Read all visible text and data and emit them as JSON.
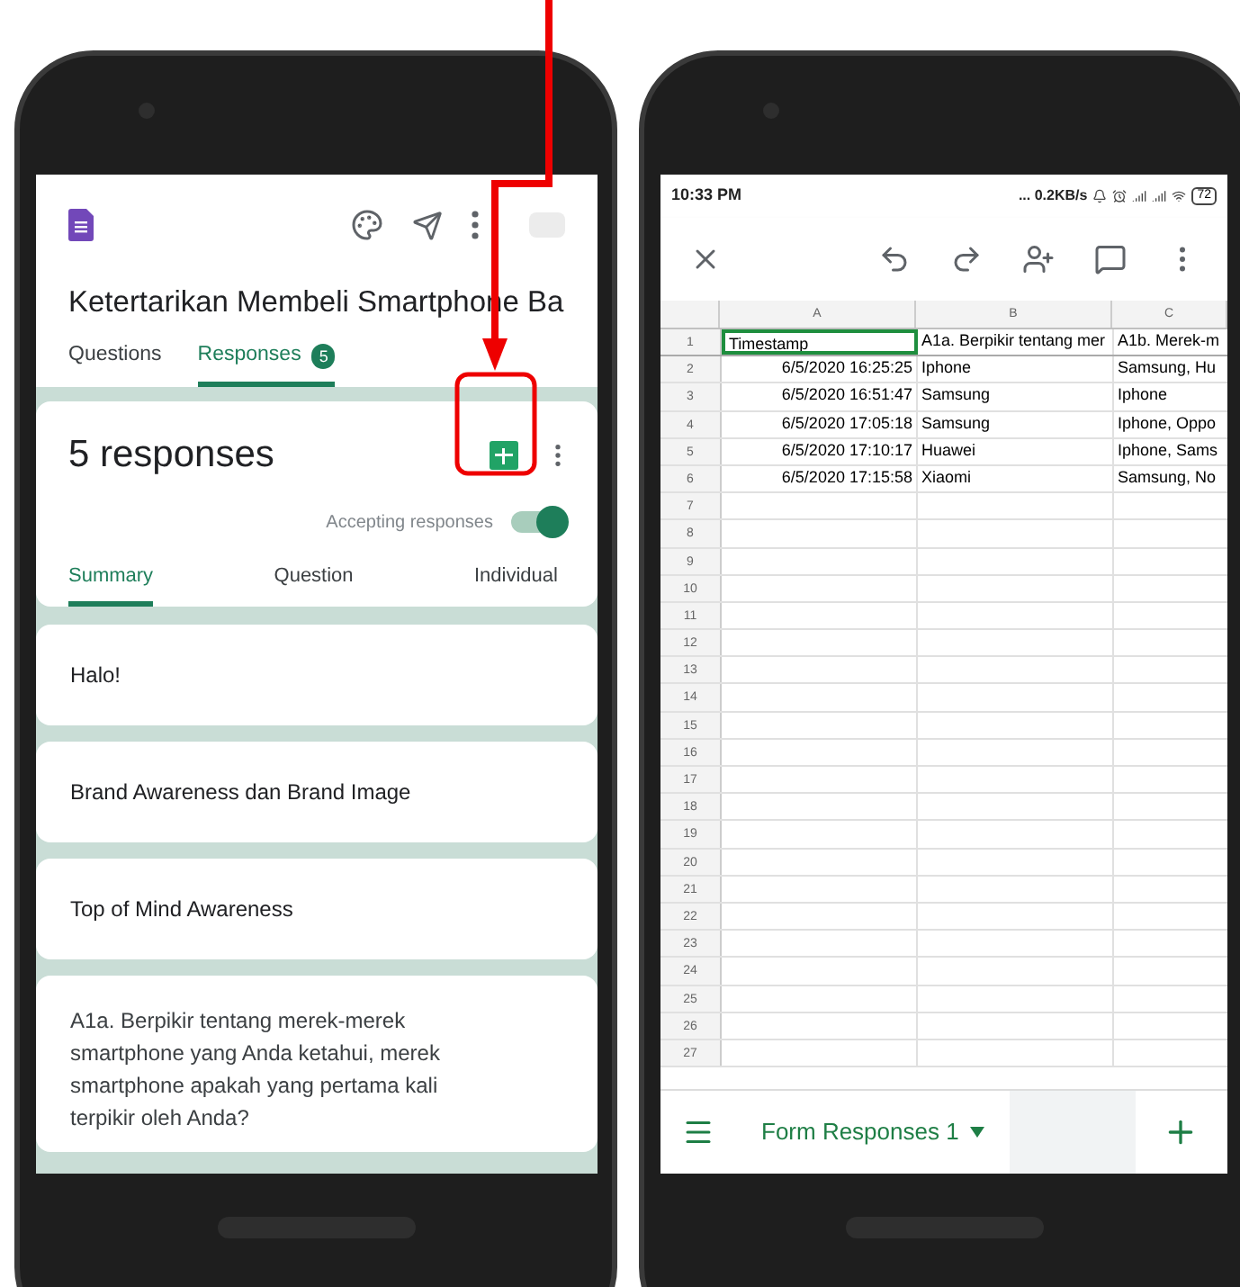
{
  "left_phone": {
    "form_title": "Ketertarikan Membeli Smartphone Ba",
    "tabs": [
      {
        "label": "Questions",
        "selected": false
      },
      {
        "label": "Responses",
        "selected": true,
        "badge": "5"
      }
    ],
    "responses_card": {
      "title": "5 responses",
      "accepting_label": "Accepting responses",
      "accepting": true,
      "subtabs": [
        {
          "label": "Summary",
          "selected": true
        },
        {
          "label": "Question",
          "selected": false
        },
        {
          "label": "Individual",
          "selected": false
        }
      ]
    },
    "cards": [
      {
        "kind": "section",
        "text": "Halo!"
      },
      {
        "kind": "section",
        "text": "Brand Awareness dan Brand Image"
      },
      {
        "kind": "section",
        "text": "Top of Mind Awareness"
      },
      {
        "kind": "question",
        "text": "A1a. Berpikir tentang merek-merek smartphone yang Anda ketahui, merek smartphone apakah yang pertama kali terpikir oleh Anda?"
      }
    ]
  },
  "right_phone": {
    "status_bar": {
      "time": "10:33 PM",
      "speed": "... 0.2KB/s",
      "battery": "72"
    },
    "columns": [
      "A",
      "B",
      "C"
    ],
    "rows": [
      {
        "number": "1",
        "cells": [
          {
            "text": "Timestamp",
            "selected": true
          },
          {
            "text": "A1a. Berpikir tentang mer",
            "selected": false
          },
          {
            "text": "A1b. Merek-m",
            "selected": false
          }
        ]
      },
      {
        "number": "2",
        "cells": [
          {
            "text": "6/5/2020 16:25:25",
            "selected": false
          },
          {
            "text": "Iphone",
            "selected": false
          },
          {
            "text": "Samsung, Hu",
            "selected": false
          }
        ]
      },
      {
        "number": "3",
        "cells": [
          {
            "text": "6/5/2020 16:51:47",
            "selected": false
          },
          {
            "text": "Samsung",
            "selected": false
          },
          {
            "text": "Iphone",
            "selected": false
          }
        ]
      },
      {
        "number": "4",
        "cells": [
          {
            "text": "6/5/2020 17:05:18",
            "selected": false
          },
          {
            "text": "Samsung",
            "selected": false
          },
          {
            "text": "Iphone, Oppo",
            "selected": false
          }
        ]
      },
      {
        "number": "5",
        "cells": [
          {
            "text": "6/5/2020 17:10:17",
            "selected": false
          },
          {
            "text": "Huawei",
            "selected": false
          },
          {
            "text": "Iphone, Sams",
            "selected": false
          }
        ]
      },
      {
        "number": "6",
        "cells": [
          {
            "text": "6/5/2020 17:15:58",
            "selected": false
          },
          {
            "text": "Xiaomi",
            "selected": false
          },
          {
            "text": "Samsung, No",
            "selected": false
          }
        ]
      },
      {
        "number": "7"
      },
      {
        "number": "8"
      },
      {
        "number": "9"
      },
      {
        "number": "10"
      },
      {
        "number": "11"
      },
      {
        "number": "12"
      },
      {
        "number": "13"
      },
      {
        "number": "14"
      },
      {
        "number": "15"
      },
      {
        "number": "16"
      },
      {
        "number": "17"
      },
      {
        "number": "18"
      },
      {
        "number": "19"
      },
      {
        "number": "20"
      },
      {
        "number": "21"
      },
      {
        "number": "22"
      },
      {
        "number": "23"
      },
      {
        "number": "24"
      },
      {
        "number": "25"
      },
      {
        "number": "26"
      },
      {
        "number": "27"
      }
    ],
    "sheet_tabs": [
      {
        "label": "Form Responses 1",
        "selected": true
      }
    ]
  }
}
